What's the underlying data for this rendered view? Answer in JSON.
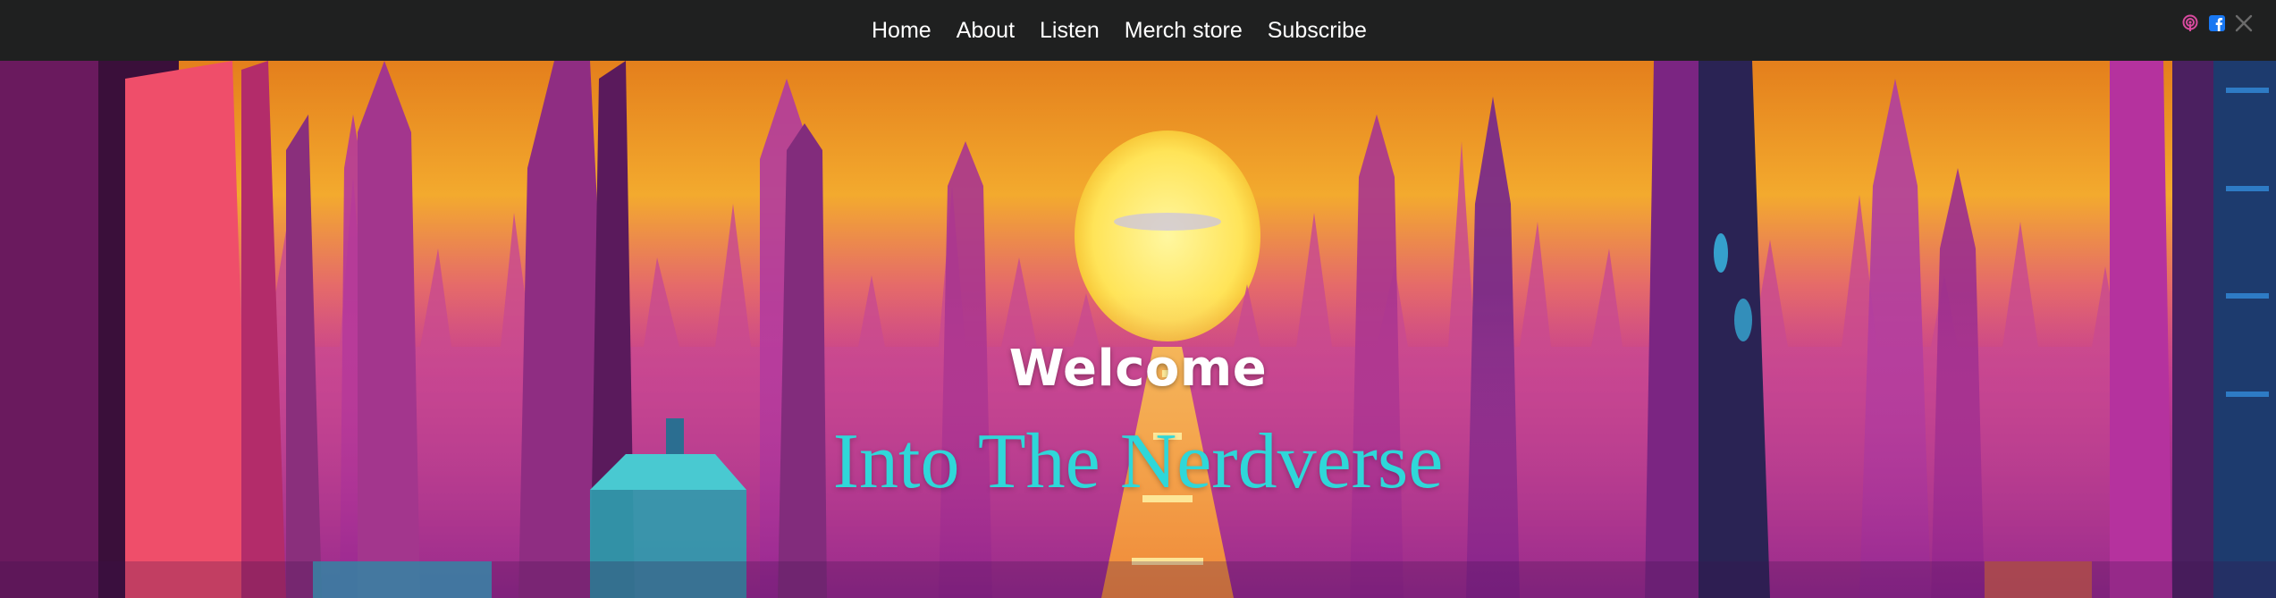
{
  "nav": {
    "items": [
      {
        "label": "Home"
      },
      {
        "label": "About"
      },
      {
        "label": "Listen"
      },
      {
        "label": "Merch store"
      },
      {
        "label": "Subscribe"
      }
    ]
  },
  "social": {
    "icons": [
      "podcast-icon",
      "facebook-icon",
      "x-icon"
    ]
  },
  "hero": {
    "welcome": "Welcome",
    "title": "Into The Nerdverse"
  },
  "colors": {
    "topbar": "#1f2020",
    "title": "#2fd7d9",
    "podcast": "#d84a9e",
    "facebook": "#1877f2",
    "x": "#6b6b6b"
  }
}
